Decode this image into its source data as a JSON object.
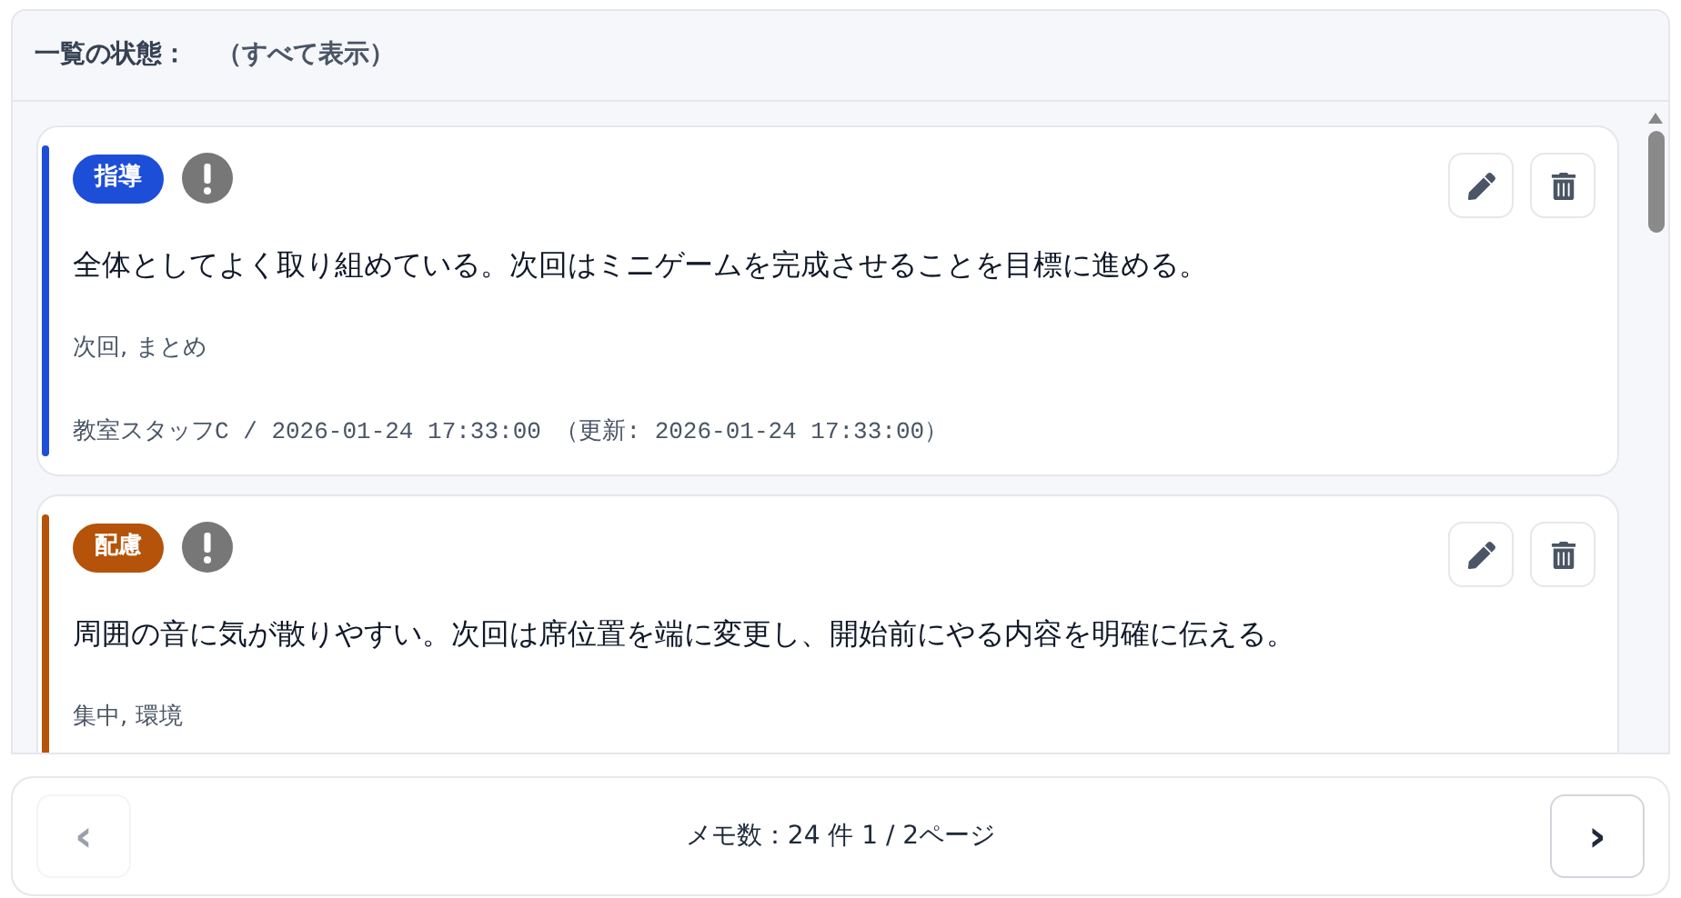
{
  "header": {
    "label": "一覧の状態：",
    "value": "（すべて表示）"
  },
  "memos": [
    {
      "category": "指導",
      "color": "#1d4ed8",
      "alert": true,
      "text": "全体としてよく取り組めている。次回はミニゲームを完成させることを目標に進める。",
      "tags": "次回, まとめ",
      "meta": "教室スタッフC / 2026-01-24 17:33:00 （更新: 2026-01-24 17:33:00）"
    },
    {
      "category": "配慮",
      "color": "#b45309",
      "alert": true,
      "text": "周囲の音に気が散りやすい。次回は席位置を端に変更し、開始前にやる内容を明確に伝える。",
      "tags": "集中, 環境"
    }
  ],
  "pagination": {
    "prev": {
      "label": "‹",
      "disabled": true
    },
    "summary": "メモ数：24 件 1 / 2ページ",
    "next": {
      "label": "›",
      "disabled": false
    }
  }
}
